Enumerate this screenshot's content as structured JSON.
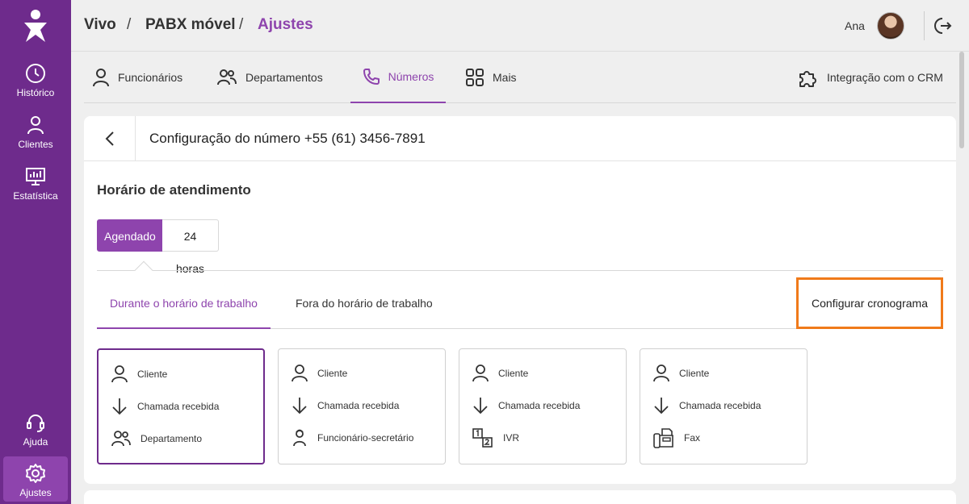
{
  "sidebar": {
    "items": [
      {
        "label": "Histórico",
        "icon": "clock-icon"
      },
      {
        "label": "Clientes",
        "icon": "person-icon"
      },
      {
        "label": "Estatística",
        "icon": "chart-icon"
      }
    ],
    "bottom_items": [
      {
        "label": "Ajuda",
        "icon": "headset-icon"
      },
      {
        "label": "Ajustes",
        "icon": "gear-icon"
      }
    ]
  },
  "breadcrumb": {
    "items": [
      "Vivo",
      "PABX móvel",
      "Ajustes"
    ],
    "separator": "/"
  },
  "user": {
    "name": "Ana"
  },
  "tabs": [
    {
      "label": "Funcionários",
      "icon": "person-icon"
    },
    {
      "label": "Departamentos",
      "icon": "people-icon"
    },
    {
      "label": "Números",
      "icon": "phone-icon"
    },
    {
      "label": "Mais",
      "icon": "grid-icon"
    }
  ],
  "crm_tab": {
    "label": "Integração com o CRM",
    "icon": "puzzle-icon"
  },
  "card": {
    "title": "Configuração do número +55 (61) 3456-7891",
    "section_title": "Horário de atendimento",
    "toggle": {
      "on": "Agendado",
      "off": "24 horas"
    },
    "subtabs": {
      "active": "Durante o horário de trabalho",
      "inactive": "Fora do horário de trabalho"
    },
    "schedule_button": "Configurar cronograma",
    "flows": [
      {
        "rows": [
          "Cliente",
          "Chamada recebida",
          "Departamento"
        ],
        "target_icon": "people-icon"
      },
      {
        "rows": [
          "Cliente",
          "Chamada recebida",
          "Funcionário-secretário"
        ],
        "target_icon": "secretary-icon"
      },
      {
        "rows": [
          "Cliente",
          "Chamada recebida",
          "IVR"
        ],
        "target_icon": "ivr-icon"
      },
      {
        "rows": [
          "Cliente",
          "Chamada recebida",
          "Fax"
        ],
        "target_icon": "fax-icon"
      }
    ]
  },
  "colors": {
    "sidebar": "#6e2b8c",
    "accent": "#8e44ad",
    "highlight": "#f07a1a"
  }
}
